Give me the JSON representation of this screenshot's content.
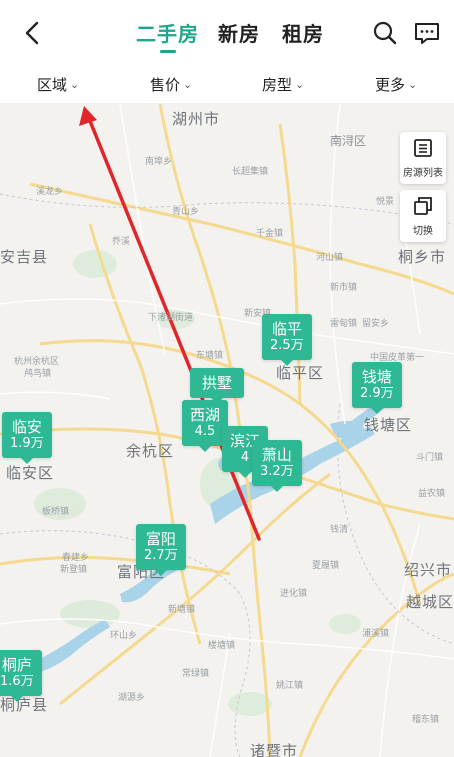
{
  "header": {
    "tabs": [
      {
        "label": "二手房",
        "active": true
      },
      {
        "label": "新房",
        "active": false
      },
      {
        "label": "租房",
        "active": false
      }
    ]
  },
  "filters": [
    {
      "label": "区域"
    },
    {
      "label": "售价"
    },
    {
      "label": "房型"
    },
    {
      "label": "更多"
    }
  ],
  "side_buttons": {
    "list_label": "房源列表",
    "switch_label": "切换"
  },
  "markers": [
    {
      "name": "临平",
      "price": "2.5万"
    },
    {
      "name": "钱塘",
      "price": "2.9万"
    },
    {
      "name": "拱墅",
      "price": ""
    },
    {
      "name": "西湖",
      "price": "4.5"
    },
    {
      "name": "滨江",
      "price": "4"
    },
    {
      "name": "萧山",
      "price": "3.2万"
    },
    {
      "name": "临安",
      "price": "1.9万"
    },
    {
      "name": "富阳",
      "price": "2.7万"
    },
    {
      "name": "桐庐",
      "price": "1.6万"
    }
  ],
  "map_labels": {
    "huzhou": "湖州市",
    "nanxun": "南浔区",
    "anji": "安吉县",
    "tongxiang": "桐乡市",
    "linping": "临平区",
    "yuhang": "余杭区",
    "qiantang": "钱塘区",
    "linan": "临安区",
    "fuyang": "富阳区",
    "shaoxing": "绍兴市",
    "yuecheng": "越城区",
    "zhuji": "诸暨市",
    "tonglu": "桐庐县",
    "hangzhou_yuhang": "杭州余杭区",
    "hangzhou_yuhang2": "鸬鸟镇"
  },
  "towns": [
    "南埠乡",
    "长超集镇",
    "溪龙乡",
    "青山乡",
    "千金镇",
    "乔溪",
    "河山镇",
    "新市镇",
    "下渚湖街道",
    "新安镇",
    "雷甸镇",
    "东塘镇",
    "中国皮革第一",
    "留安乡",
    "板桥镇",
    "春建乡",
    "进化镇",
    "湖源乡",
    "常绿镇",
    "楼塘镇",
    "新塘镇",
    "浦溪镇",
    "夏履镇",
    "益农镇",
    "斗门镇",
    "环山乡",
    "钱清",
    "新登镇",
    "姚江镇",
    "稽东镇",
    "悦景"
  ],
  "colors": {
    "accent": "#1ea68a",
    "marker": "#2fb894",
    "arrow": "#e0262a",
    "water": "#a9d3e8",
    "road": "#f6d88a"
  }
}
